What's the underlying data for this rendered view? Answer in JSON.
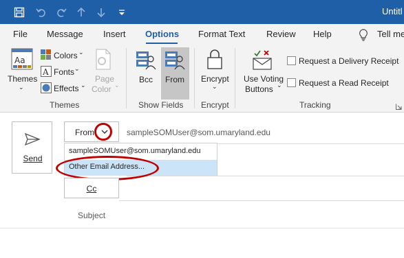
{
  "window": {
    "title": "Untitl"
  },
  "tabs": [
    {
      "label": "File"
    },
    {
      "label": "Message"
    },
    {
      "label": "Insert"
    },
    {
      "label": "Options",
      "active": true
    },
    {
      "label": "Format Text"
    },
    {
      "label": "Review"
    },
    {
      "label": "Help"
    },
    {
      "label": "Tell me"
    }
  ],
  "ribbon": {
    "themes": {
      "label": "Themes",
      "colors": "Colors",
      "fonts": "Fonts",
      "effects": "Effects",
      "page_color_1": "Page",
      "page_color_2": "Color",
      "group": "Themes"
    },
    "show_fields": {
      "bcc": "Bcc",
      "from": "From",
      "group": "Show Fields"
    },
    "encrypt": {
      "label": "Encrypt",
      "group": "Encrypt"
    },
    "tracking": {
      "voting_1": "Use Voting",
      "voting_2": "Buttons",
      "delivery_receipt": "Request a Delivery Receipt",
      "read_receipt": "Request a Read Receipt",
      "group": "Tracking"
    }
  },
  "compose": {
    "send": "Send",
    "from_button": "From",
    "from_address": "sampleSOMUser@som.umaryland.edu",
    "cc_button": "Cc",
    "subject_label": "Subject",
    "dropdown": [
      {
        "label": "sampleSOMUser@som.umaryland.edu"
      },
      {
        "label": "Other Email Address...",
        "highlighted": true
      }
    ]
  },
  "colors": {
    "accent": "#1f5fa8",
    "annotation": "#c00000",
    "highlight": "#cce4f7"
  }
}
